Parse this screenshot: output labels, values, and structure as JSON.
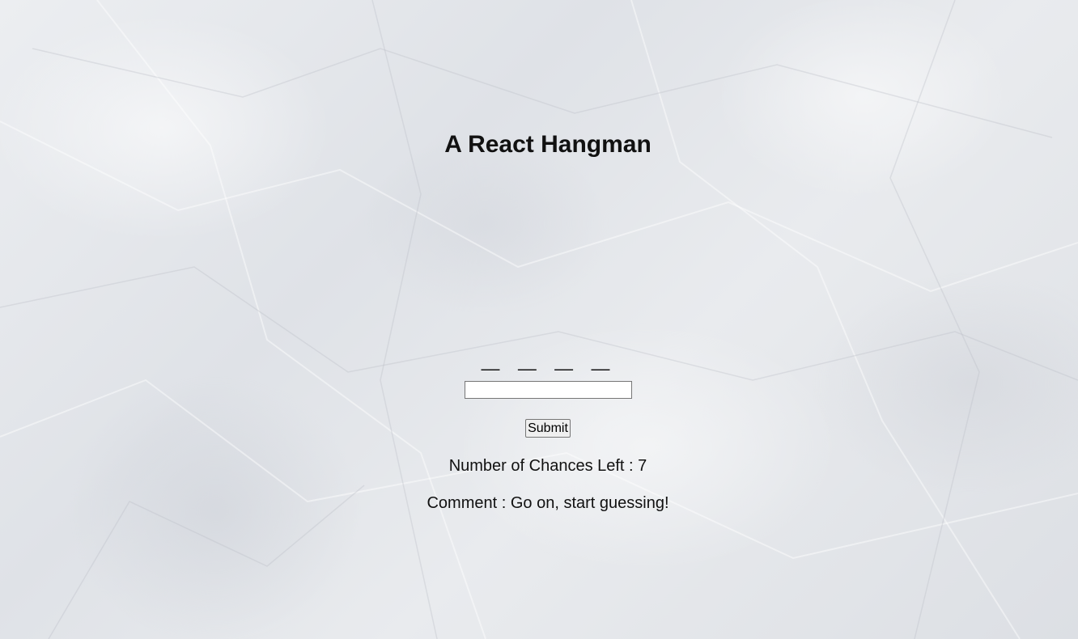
{
  "game": {
    "title": "A React Hangman",
    "word_display": "_ _ _ _",
    "guess_input": {
      "value": "",
      "placeholder": ""
    },
    "submit_label": "Submit",
    "chances_label": "Number of Chances Left : 7",
    "comment_label": "Comment : Go on, start guessing!"
  },
  "colors": {
    "text": "#111111",
    "background": "#e4e6ea"
  }
}
